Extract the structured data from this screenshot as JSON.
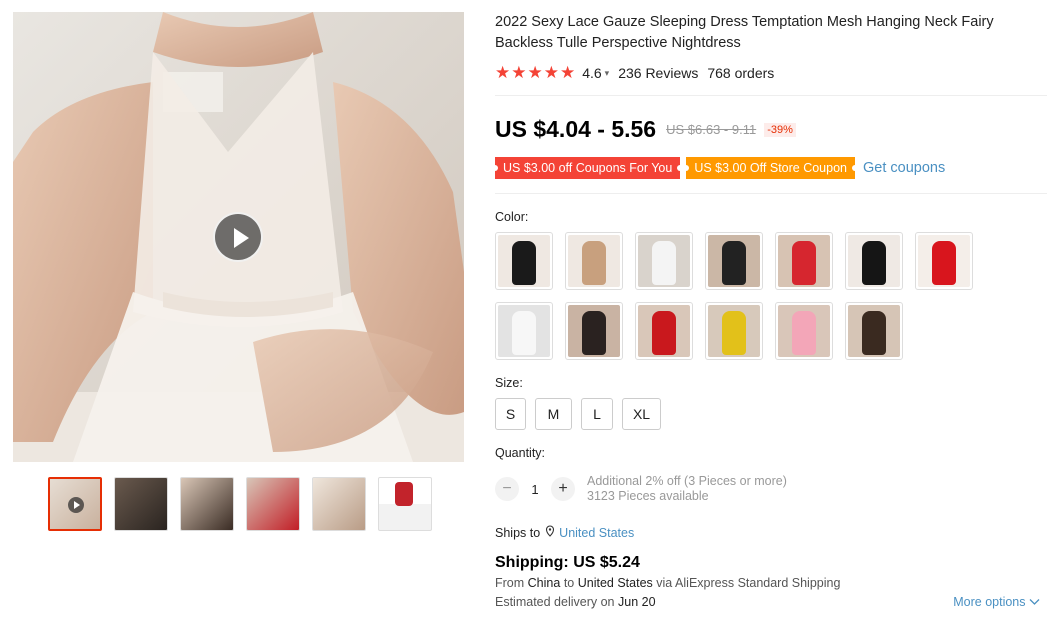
{
  "product": {
    "title": "2022 Sexy Lace Gauze Sleeping Dress Temptation Mesh Hanging Neck Fairy Backless Tulle Perspective Nightdress",
    "stars": "★★★★★",
    "rating": "4.6",
    "reviews": "236 Reviews",
    "orders": "768 orders"
  },
  "price": {
    "current": "US $4.04 - 5.56",
    "original": "US $6.63 - 9.11",
    "discount": "-39%"
  },
  "coupons": {
    "coupon1": "US $3.00 off Coupons For You",
    "coupon2": "US $3.00 Off Store Coupon",
    "get": "Get coupons"
  },
  "color": {
    "label": "Color:",
    "swatches": [
      "#1a1a1a",
      "#c8a07e",
      "#f4f4f4",
      "#222222",
      "#d6262f",
      "#151515",
      "#d8151d",
      "#f7f7f7",
      "#2a2220",
      "#c9181d",
      "#e2c11a",
      "#f3a6b8",
      "#3a2a20"
    ]
  },
  "size": {
    "label": "Size:",
    "options": [
      "S",
      "M",
      "L",
      "XL"
    ]
  },
  "quantity": {
    "label": "Quantity:",
    "value": "1",
    "minus": "−",
    "plus": "+",
    "note1": "Additional 2% off (3 Pieces or more)",
    "note2": "3123 Pieces available"
  },
  "shipping": {
    "ships_to_label": "Ships to",
    "ships_to": "United States",
    "title": "Shipping: US $5.24",
    "from_prefix": "From",
    "from": "China",
    "to_prefix": "to",
    "to": "United States",
    "via_prefix": "via",
    "via": "AliExpress Standard Shipping",
    "delivery_prefix": "Estimated delivery on",
    "delivery": "Jun 20",
    "more": "More options"
  },
  "thumbnails": [
    "video",
    "black",
    "black-back",
    "red",
    "white-lace",
    "size-chart"
  ],
  "icons": {
    "play": "play-icon",
    "location": "location-pin-icon",
    "chevron": "chevron-down-icon"
  }
}
